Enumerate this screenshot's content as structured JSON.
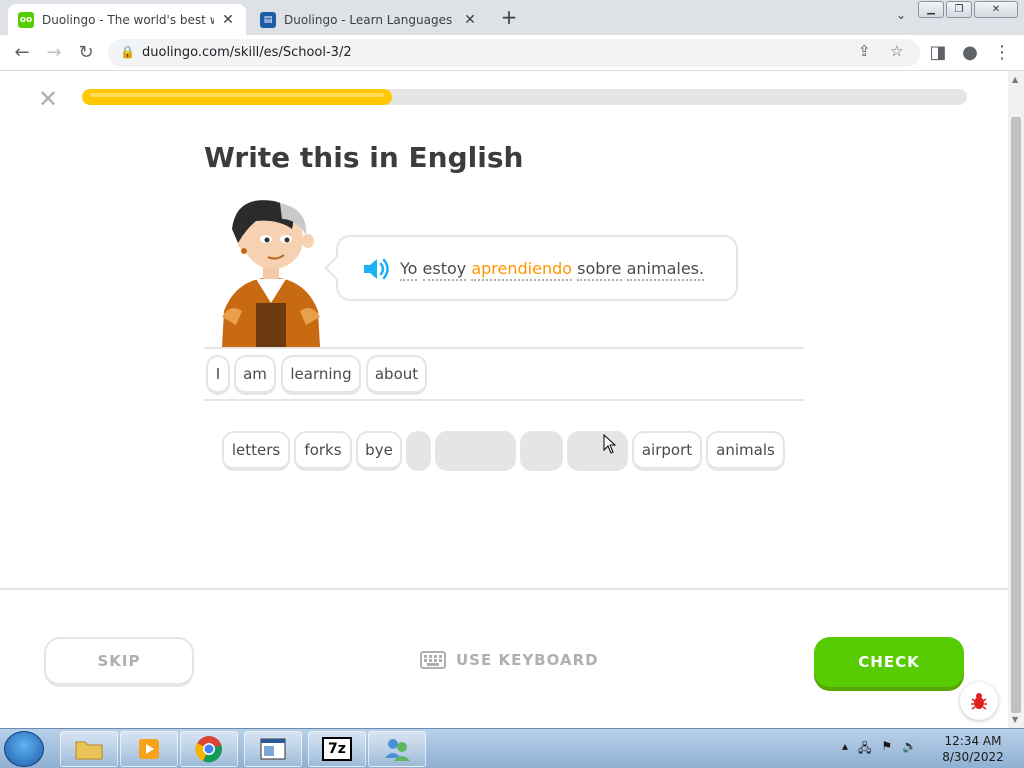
{
  "browser": {
    "tabs": [
      {
        "title": "Duolingo - The world's best way",
        "active": true,
        "favicon": "duolingo-owl-icon"
      },
      {
        "title": "Duolingo - Learn Languages for f",
        "active": false,
        "favicon": "duolingo-book-icon"
      }
    ],
    "url": "duolingo.com/skill/es/School-3/2",
    "new_tab_label": "+",
    "tab_close_label": "✕"
  },
  "lesson": {
    "progress": 0.35,
    "title": "Write this in English",
    "prompt_words": [
      "Yo",
      "estoy",
      "aprendiendo",
      "sobre",
      "animales."
    ],
    "highlighted_word": "aprendiendo",
    "answer_chips": [
      "I",
      "am",
      "learning",
      "about"
    ],
    "word_bank": [
      {
        "label": "letters",
        "used": false
      },
      {
        "label": "forks",
        "used": false
      },
      {
        "label": "bye",
        "used": false
      },
      {
        "label": "",
        "used": true
      },
      {
        "label": "",
        "used": true
      },
      {
        "label": "",
        "used": true
      },
      {
        "label": "",
        "used": true
      },
      {
        "label": "airport",
        "used": false
      },
      {
        "label": "animals",
        "used": false
      }
    ]
  },
  "footer": {
    "skip_label": "SKIP",
    "keyboard_label": "USE KEYBOARD",
    "check_label": "CHECK"
  },
  "colors": {
    "progress": "#ffc800",
    "check": "#58cc02",
    "highlight": "#ff9600",
    "speaker": "#1cb0f6"
  },
  "taskbar": {
    "time": "12:34 AM",
    "date": "8/30/2022",
    "apps": [
      "folder-icon",
      "media-player-icon",
      "chrome-icon",
      "document-viewer-icon",
      "7zip-icon",
      "network-users-icon"
    ],
    "apps_7zip_label": "7z"
  }
}
